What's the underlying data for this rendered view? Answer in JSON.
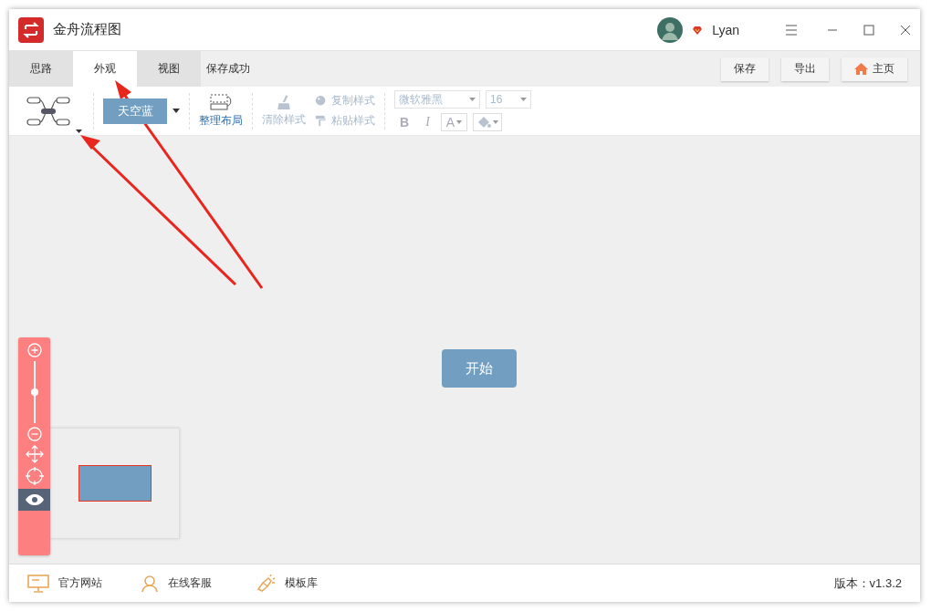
{
  "window": {
    "title": "金舟流程图",
    "user": "Lyan"
  },
  "tabs": [
    {
      "label": "思路",
      "selected": false
    },
    {
      "label": "外观",
      "selected": true
    },
    {
      "label": "视图",
      "selected": false
    }
  ],
  "status_text": "保存成功",
  "actions": [
    {
      "label": "保存",
      "kind": "plain"
    },
    {
      "label": "导出",
      "kind": "plain"
    },
    {
      "label": "主页",
      "kind": "home"
    }
  ],
  "toolbar": {
    "theme": "天空蓝",
    "layout": "整理布局",
    "styles": [
      {
        "label": "清除样式",
        "disabled": true,
        "kind": "clear"
      },
      {
        "label": "复制样式",
        "disabled": true,
        "kind": "copy"
      },
      {
        "label": "粘贴样式",
        "disabled": true,
        "kind": "paste"
      }
    ],
    "font": "微软雅黑",
    "size": "16",
    "bold": "B",
    "italic": "I",
    "font_color": "A"
  },
  "canvas": {
    "node": "开始",
    "zoom": {
      "level": 0.5
    },
    "preview": {
      "on": true
    }
  },
  "footer": {
    "links": [
      {
        "label": "官方网站",
        "kind": "monitor"
      },
      {
        "label": "在线客服",
        "kind": "person"
      },
      {
        "label": "模板库",
        "kind": "flashlight"
      }
    ],
    "version": "版本：v1.3.2"
  }
}
